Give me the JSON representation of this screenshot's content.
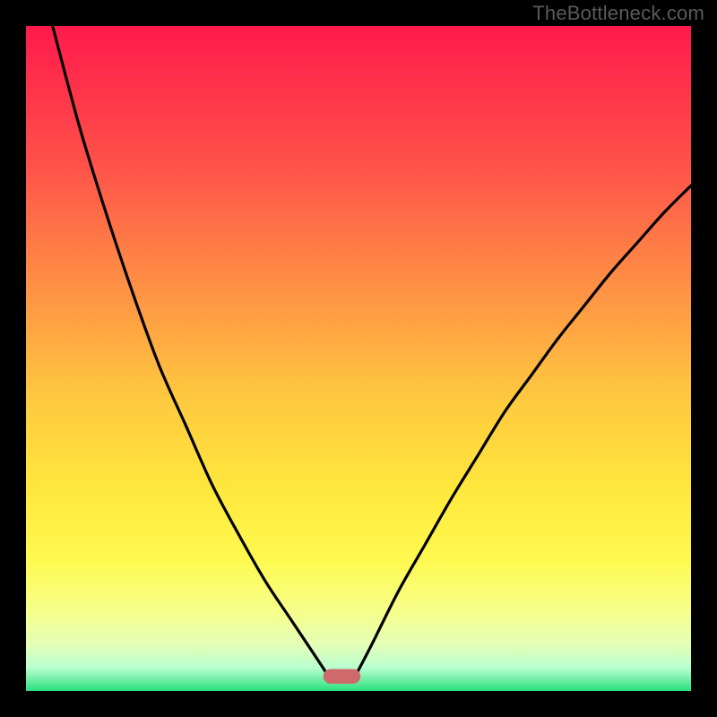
{
  "watermark": "TheBottleneck.com",
  "chart_data": {
    "type": "line",
    "title": "",
    "xlabel": "",
    "ylabel": "",
    "xlim": [
      0,
      100
    ],
    "ylim": [
      0,
      100
    ],
    "series": [
      {
        "name": "left-curve",
        "x": [
          4,
          8,
          12,
          16,
          20,
          24,
          28,
          32,
          36,
          40,
          44,
          45.5
        ],
        "y": [
          100,
          85,
          72,
          60,
          49,
          40,
          31,
          23.5,
          16.5,
          10.5,
          4.5,
          2.2
        ]
      },
      {
        "name": "right-curve",
        "x": [
          49.5,
          52,
          56,
          60,
          64,
          68,
          72,
          76,
          80,
          84,
          88,
          92,
          96,
          100
        ],
        "y": [
          2.2,
          7,
          15,
          22,
          29,
          35.5,
          42,
          47.5,
          53,
          58,
          63,
          67.5,
          72,
          76
        ]
      }
    ],
    "marker": {
      "name": "highlight-pill",
      "cx": 47.5,
      "cy": 2.2,
      "w": 5.6,
      "h": 2.2,
      "fill": "#cf6a6c"
    },
    "gradient": {
      "stops": [
        {
          "offset": 0,
          "color": "#ff1a4b"
        },
        {
          "offset": 0.2,
          "color": "#ff4f4a"
        },
        {
          "offset": 0.4,
          "color": "#ff9344"
        },
        {
          "offset": 0.56,
          "color": "#ffc93f"
        },
        {
          "offset": 0.7,
          "color": "#ffe83d"
        },
        {
          "offset": 0.8,
          "color": "#fff94e"
        },
        {
          "offset": 0.88,
          "color": "#f6ff8a"
        },
        {
          "offset": 0.93,
          "color": "#e4ffb6"
        },
        {
          "offset": 0.965,
          "color": "#b9ffd0"
        },
        {
          "offset": 1.0,
          "color": "#29e07c"
        }
      ]
    },
    "colors": {
      "curve": "#000000",
      "background_outer": "#000000"
    }
  }
}
